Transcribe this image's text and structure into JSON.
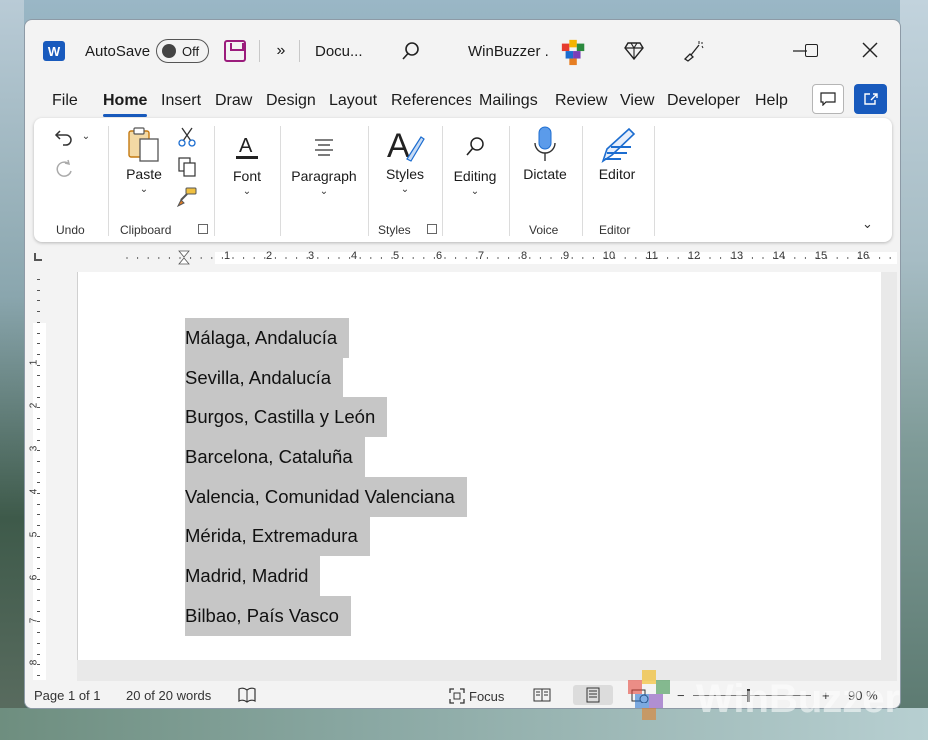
{
  "titlebar": {
    "app_logo": "W",
    "autosave_label": "AutoSave",
    "autosave_state": "Off",
    "doc_name": "Docu...",
    "user_name": "WinBuzzer ."
  },
  "tabs": [
    "File",
    "Home",
    "Insert",
    "Draw",
    "Design",
    "Layout",
    "References",
    "Mailings",
    "Review",
    "View",
    "Developer",
    "Help"
  ],
  "active_tab": "Home",
  "ribbon": {
    "undo_group": "Undo",
    "clipboard": {
      "paste": "Paste",
      "group": "Clipboard"
    },
    "font": "Font",
    "paragraph": "Paragraph",
    "styles": {
      "button": "Styles",
      "group": "Styles"
    },
    "editing": "Editing",
    "voice": {
      "button": "Dictate",
      "group": "Voice"
    },
    "editor": {
      "button": "Editor",
      "group": "Editor"
    }
  },
  "ruler": {
    "h_numbers": [
      "1",
      "2",
      "3",
      "4",
      "5",
      "6",
      "7",
      "8",
      "9",
      "10",
      "11",
      "12",
      "13",
      "14",
      "15",
      "16"
    ],
    "v_numbers": [
      "1",
      "2",
      "3",
      "4",
      "5",
      "6",
      "7",
      "8"
    ]
  },
  "document": {
    "lines": [
      "Málaga, Andalucía",
      "Sevilla, Andalucía",
      "Burgos, Castilla y León",
      "Barcelona, Cataluña",
      "Valencia, Comunidad Valenciana",
      "Mérida, Extremadura",
      "Madrid, Madrid",
      "Bilbao, País Vasco"
    ],
    "selection_color": "#c6c6c6"
  },
  "statusbar": {
    "page": "Page 1 of 1",
    "words": "20 of 20 words",
    "focus": "Focus",
    "zoom": "90 %"
  },
  "colors": {
    "accent": "#185abd"
  }
}
